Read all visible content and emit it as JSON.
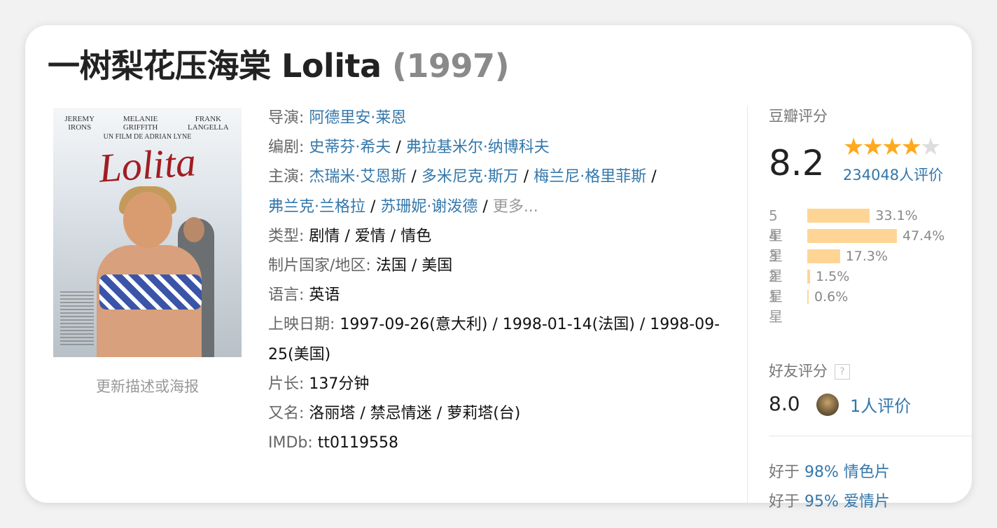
{
  "title": {
    "name": "一树梨花压海棠 Lolita",
    "year": "(1997)"
  },
  "poster": {
    "top_names": [
      "JEREMY IRONS",
      "MELANIE GRIFFITH",
      "FRANK LANGELLA"
    ],
    "byline": "UN FILM DE ADRIAN LYNE",
    "script_title": "Lolita",
    "update_link": "更新描述或海报"
  },
  "info": {
    "director_label": "导演: ",
    "directors": [
      "阿德里安·莱恩"
    ],
    "writer_label": "编剧: ",
    "writers": [
      "史蒂芬·希夫",
      "弗拉基米尔·纳博科夫"
    ],
    "cast_label": "主演: ",
    "cast": [
      "杰瑞米·艾恩斯",
      "多米尼克·斯万",
      "梅兰尼·格里菲斯",
      "弗兰克·兰格拉",
      "苏珊妮·谢泼德"
    ],
    "more": "更多...",
    "genre_label": "类型: ",
    "genre": "剧情 / 爱情 / 情色",
    "country_label": "制片国家/地区: ",
    "country": "法国 / 美国",
    "language_label": "语言: ",
    "language": "英语",
    "release_label": "上映日期: ",
    "release": "1997-09-26(意大利) / 1998-01-14(法国) / 1998-09-25(美国)",
    "runtime_label": "片长: ",
    "runtime": "137分钟",
    "aka_label": "又名: ",
    "aka": "洛丽塔 / 禁忌情迷 / 萝莉塔(台)",
    "imdb_label": "IMDb: ",
    "imdb": "tt0119558",
    "separator": " / "
  },
  "rating": {
    "section_title": "豆瓣评分",
    "score": "8.2",
    "stars": 4,
    "count": "234048人评价",
    "distribution": [
      {
        "label": "5星",
        "percent": "33.1%",
        "value": 33.1
      },
      {
        "label": "4星",
        "percent": "47.4%",
        "value": 47.4
      },
      {
        "label": "3星",
        "percent": "17.3%",
        "value": 17.3
      },
      {
        "label": "2星",
        "percent": "1.5%",
        "value": 1.5
      },
      {
        "label": "1星",
        "percent": "0.6%",
        "value": 0.6
      }
    ],
    "bar_color": "#ffd596",
    "star_color": "#ffa91e"
  },
  "friends": {
    "title": "好友评分",
    "help": "?",
    "score": "8.0",
    "count": "1人评价"
  },
  "better_than": [
    {
      "prefix": "好于 ",
      "percent": "98%",
      "genre": "情色片"
    },
    {
      "prefix": "好于 ",
      "percent": "95%",
      "genre": "爱情片"
    }
  ],
  "colors": {
    "link": "#3377aa",
    "label": "#666666",
    "muted": "#999999"
  }
}
